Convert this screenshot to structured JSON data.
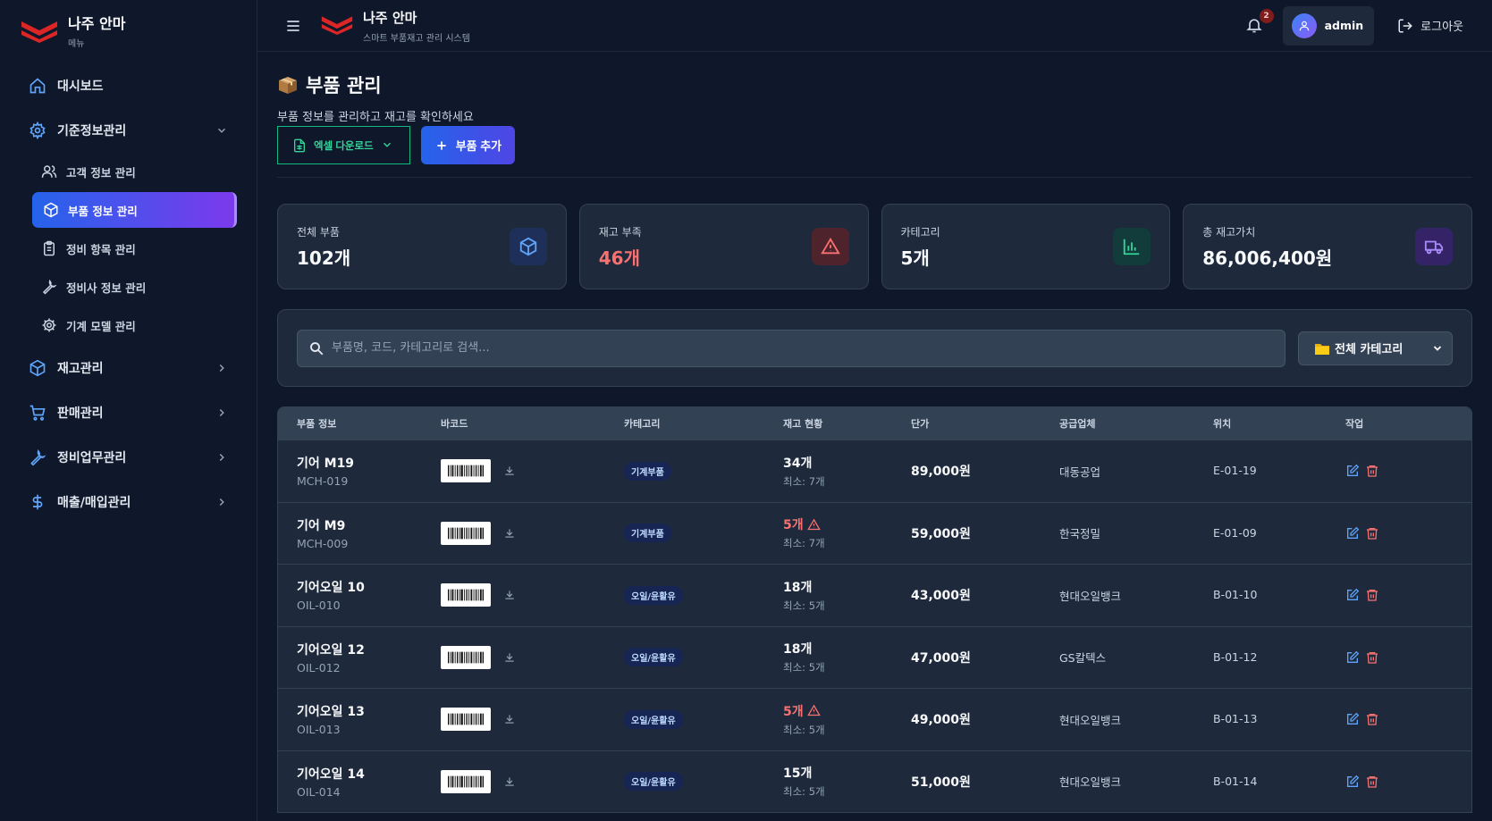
{
  "sidebar": {
    "brand_title": "나주 안마",
    "brand_sub": "메뉴",
    "items": [
      {
        "label": "대시보드",
        "icon": "home-icon"
      },
      {
        "label": "기준정보관리",
        "icon": "gear-icon",
        "expanded": true,
        "children": [
          {
            "label": "고객 정보 관리",
            "icon": "users-icon"
          },
          {
            "label": "부품 정보 관리",
            "icon": "box-icon",
            "active": true
          },
          {
            "label": "정비 항목 관리",
            "icon": "clipboard-icon"
          },
          {
            "label": "정비사 정보 관리",
            "icon": "wrench-icon"
          },
          {
            "label": "기계 모델 관리",
            "icon": "cog-icon"
          }
        ]
      },
      {
        "label": "재고관리",
        "icon": "box-icon"
      },
      {
        "label": "판매관리",
        "icon": "cart-icon"
      },
      {
        "label": "정비업무관리",
        "icon": "wrench-icon"
      },
      {
        "label": "매출/매입관리",
        "icon": "dollar-icon"
      }
    ]
  },
  "topbar": {
    "title": "나주 안마",
    "subtitle": "스마트 부품재고 관리 시스템",
    "notification_count": "2",
    "user_name": "admin",
    "logout_label": "로그아웃"
  },
  "page": {
    "title": "부품 관리",
    "subtitle": "부품 정보를 관리하고 재고를 확인하세요",
    "excel_label": "엑셀 다운로드",
    "add_label": "부품 추가"
  },
  "stats": [
    {
      "label": "전체 부품",
      "value": "102개",
      "icon": "cube-icon",
      "color": "#60a5fa"
    },
    {
      "label": "재고 부족",
      "value": "46개",
      "icon": "warning-icon",
      "color": "#f87171"
    },
    {
      "label": "카테고리",
      "value": "5개",
      "icon": "bar-chart-icon",
      "color": "#34d399"
    },
    {
      "label": "총 재고가치",
      "value": "86,006,400원",
      "icon": "truck-icon",
      "color": "#a78bfa"
    }
  ],
  "search": {
    "placeholder": "부품명, 코드, 카테고리로 검색...",
    "category_selected": "전체 카테고리"
  },
  "table": {
    "headers": [
      "부품 정보",
      "바코드",
      "카테고리",
      "재고 현황",
      "단가",
      "공급업체",
      "위치",
      "작업"
    ],
    "rows": [
      {
        "name": "기어 M19",
        "code": "MCH-019",
        "category": "기계부품",
        "stock": "34개",
        "low": false,
        "min": "최소: 7개",
        "price": "89,000원",
        "supplier": "대동공업",
        "location": "E-01-19"
      },
      {
        "name": "기어 M9",
        "code": "MCH-009",
        "category": "기계부품",
        "stock": "5개",
        "low": true,
        "min": "최소: 7개",
        "price": "59,000원",
        "supplier": "한국정밀",
        "location": "E-01-09"
      },
      {
        "name": "기어오일 10",
        "code": "OIL-010",
        "category": "오일/윤활유",
        "stock": "18개",
        "low": false,
        "min": "최소: 5개",
        "price": "43,000원",
        "supplier": "현대오일뱅크",
        "location": "B-01-10"
      },
      {
        "name": "기어오일 12",
        "code": "OIL-012",
        "category": "오일/윤활유",
        "stock": "18개",
        "low": false,
        "min": "최소: 5개",
        "price": "47,000원",
        "supplier": "GS칼텍스",
        "location": "B-01-12"
      },
      {
        "name": "기어오일 13",
        "code": "OIL-013",
        "category": "오일/윤활유",
        "stock": "5개",
        "low": true,
        "min": "최소: 5개",
        "price": "49,000원",
        "supplier": "현대오일뱅크",
        "location": "B-01-13"
      },
      {
        "name": "기어오일 14",
        "code": "OIL-014",
        "category": "오일/윤활유",
        "stock": "15개",
        "low": false,
        "min": "최소: 5개",
        "price": "51,000원",
        "supplier": "현대오일뱅크",
        "location": "B-01-14"
      }
    ]
  }
}
